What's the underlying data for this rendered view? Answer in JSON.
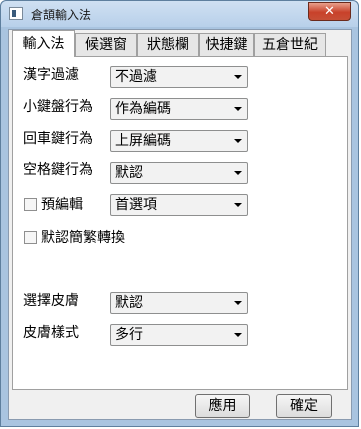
{
  "window": {
    "title": "倉頡輸入法",
    "close_label": "✕"
  },
  "tabs": [
    {
      "label": "輸入法",
      "active": true
    },
    {
      "label": "候選窗",
      "active": false
    },
    {
      "label": "狀態欄",
      "active": false
    },
    {
      "label": "快捷鍵",
      "active": false
    },
    {
      "label": "五倉世紀",
      "active": false
    }
  ],
  "settings": {
    "hanzi_filter": {
      "label": "漢字過濾",
      "value": "不過濾"
    },
    "keypad_behavior": {
      "label": "小鍵盤行為",
      "value": "作為編碼"
    },
    "enter_behavior": {
      "label": "回車鍵行為",
      "value": "上屏編碼"
    },
    "space_behavior": {
      "label": "空格鍵行為",
      "value": "默認"
    },
    "preedit": {
      "label": "預編輯",
      "value": "首選項",
      "checked": false
    },
    "default_conversion": {
      "label": "默認簡繁轉換",
      "checked": false
    },
    "skin_select": {
      "label": "選擇皮膚",
      "value": "默認"
    },
    "skin_style": {
      "label": "皮膚樣式",
      "value": "多行"
    }
  },
  "buttons": {
    "apply": "應用",
    "ok": "確定"
  }
}
